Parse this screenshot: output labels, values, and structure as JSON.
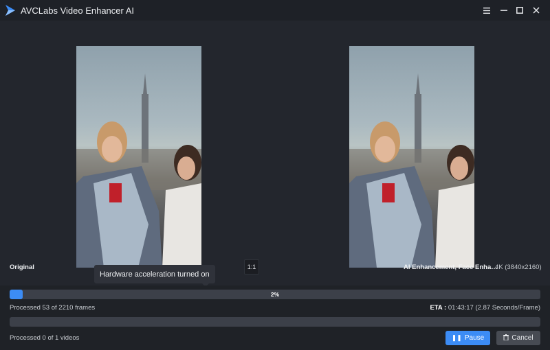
{
  "app": {
    "title": "AVCLabs Video Enhancer AI",
    "accent": "#3c8cf5"
  },
  "window_controls": {
    "menu_icon": "hamburger-menu-icon",
    "minimize_icon": "minimize-icon",
    "maximize_icon": "maximize-icon",
    "close_icon": "close-icon"
  },
  "preview": {
    "left_label": "Original",
    "right_label": "AI Enhancement, Face Enha…",
    "right_resolution": "4K (3840x2160)",
    "ratio_button": "1:1"
  },
  "tooltip": {
    "text": "Hardware acceleration turned on"
  },
  "progress": {
    "frame_percent_label": "2%",
    "frame_fraction": 0.024,
    "frames_text": "Processed 53 of 2210 frames",
    "eta_label": "ETA :",
    "eta_value": " 01:43:17 (2.87 Seconds/Frame)",
    "video_fraction": 0,
    "videos_text": "Processed 0 of 1 videos"
  },
  "buttons": {
    "pause_label": "Pause",
    "cancel_label": "Cancel"
  }
}
